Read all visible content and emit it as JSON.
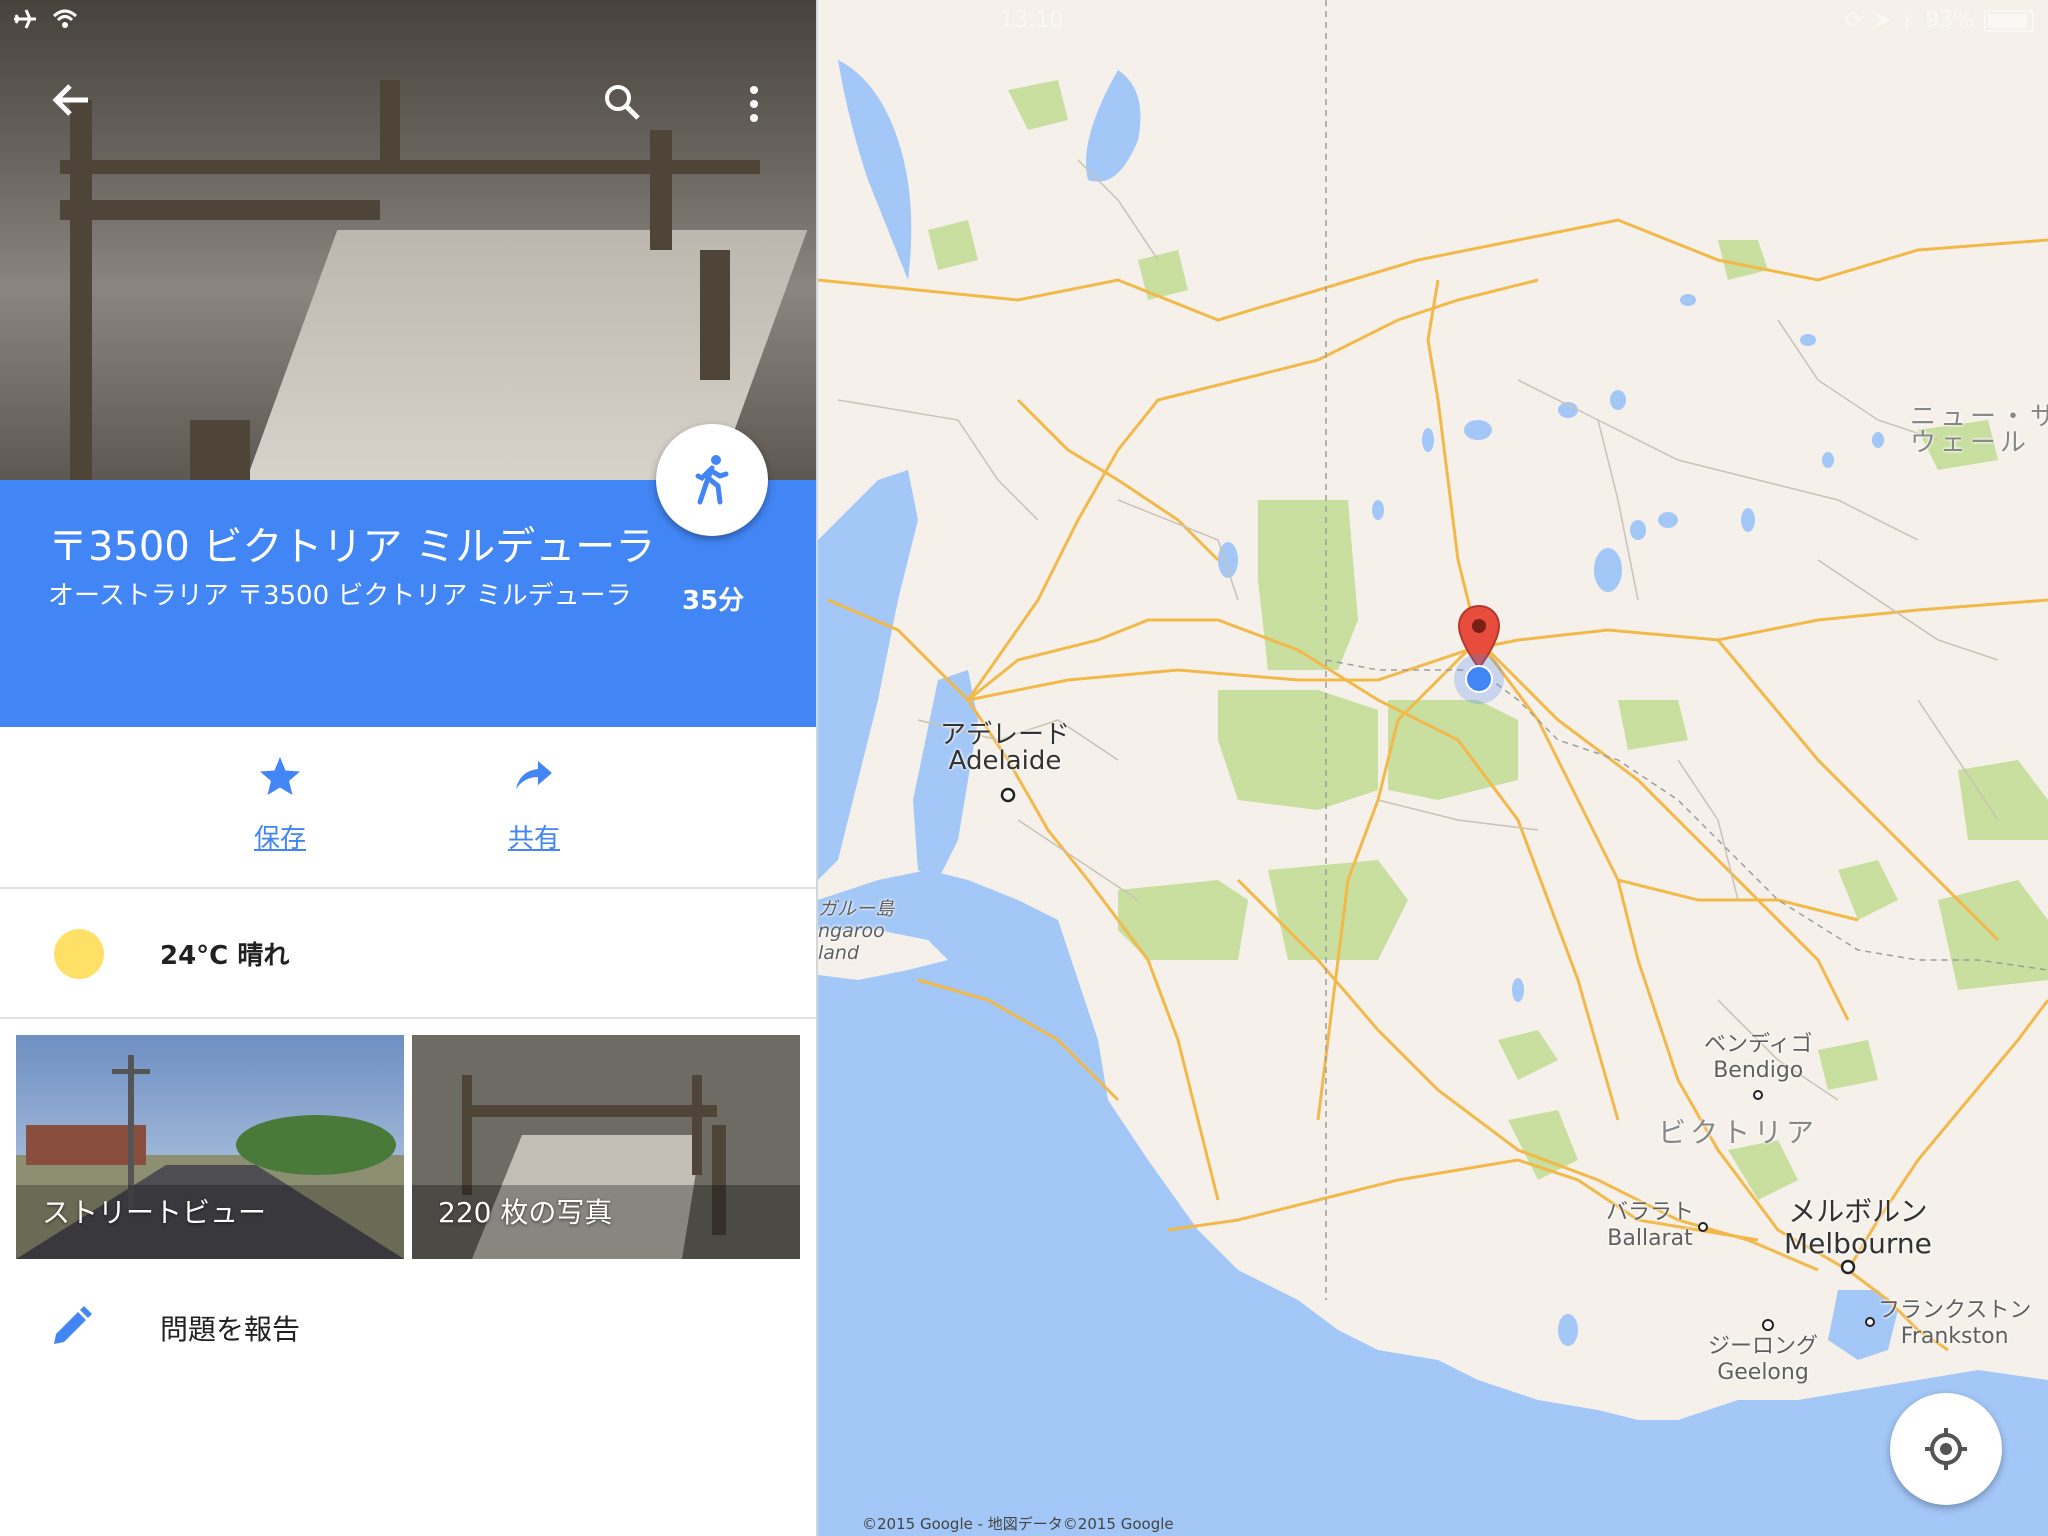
{
  "status_bar": {
    "time": "13:10",
    "battery": "93%"
  },
  "place": {
    "title": "〒3500 ビクトリア ミルデューラ",
    "address": "オーストラリア 〒3500 ビクトリア ミルデューラ",
    "travel_time": "35分"
  },
  "actions": {
    "save_label": "保存",
    "share_label": "共有"
  },
  "weather": {
    "text": "24°C 晴れ"
  },
  "photos": {
    "street_view_label": "ストリートビュー",
    "photos_label": "220 枚の写真"
  },
  "report": {
    "label": "問題を報告"
  },
  "map": {
    "labels": {
      "adelaide_ja": "アデレード",
      "adelaide_en": "Adelaide",
      "kangaroo_ja": "ガルー島",
      "kangaroo_en1": "ngaroo",
      "kangaroo_en2": "land",
      "bendigo_ja": "ベンディゴ",
      "bendigo_en": "Bendigo",
      "victoria": "ビクトリア",
      "ballarat_ja": "バララト",
      "ballarat_en": "Ballarat",
      "melbourne_ja": "メルボルン",
      "melbourne_en": "Melbourne",
      "frankston_ja": "フランクストン",
      "frankston_en": "Frankston",
      "geelong_ja": "ジーロング",
      "geelong_en": "Geelong",
      "nsw_1": "ニュー・サ",
      "nsw_2": "ウェール"
    },
    "copyright": "©2015 Google - 地図データ©2015 Google"
  },
  "colors": {
    "header_blue": "#4285f4",
    "sea": "#a3c7f7",
    "land": "#f5f1ea",
    "park": "#c8df9f",
    "road": "#f2b94a",
    "marker_red": "#e74c3c"
  }
}
